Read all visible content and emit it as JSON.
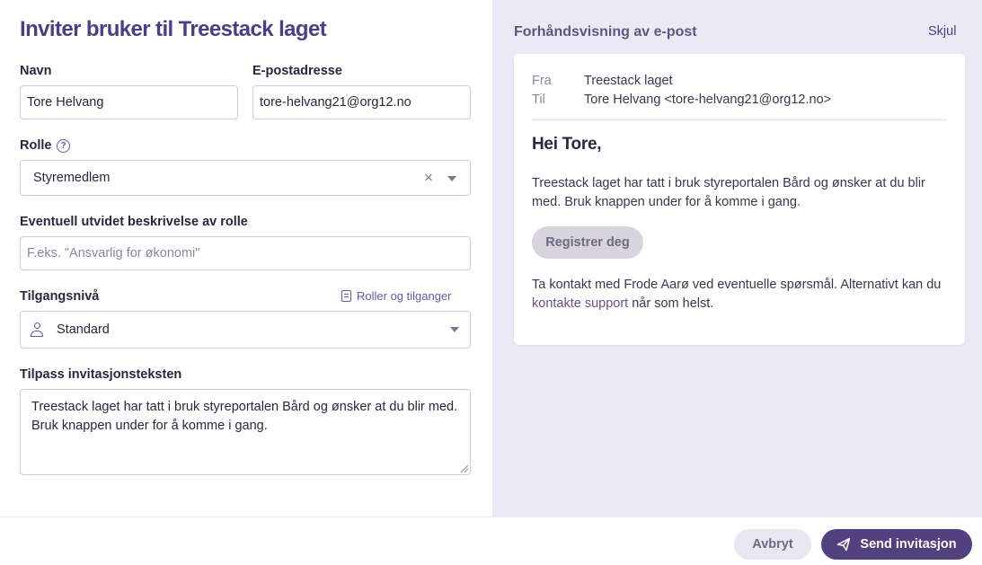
{
  "form": {
    "title": "Inviter bruker til Treestack laget",
    "name_label": "Navn",
    "name_value": "Tore Helvang",
    "email_label": "E-postadresse",
    "email_value": "tore-helvang21@org12.no",
    "role_label": "Rolle",
    "role_help_icon": "?",
    "role_value": "Styremedlem",
    "role_clear": "×",
    "role_description_label": "Eventuell utvidet beskrivelse av rolle",
    "role_description_placeholder": "F.eks. \"Ansvarlig for økonomi\"",
    "access_label": "Tilgangsnivå",
    "roles_link": "Roller og tilganger",
    "access_value": "Standard",
    "invitation_text_label": "Tilpass invitasjonsteksten",
    "invitation_text": "Treestack laget har tatt i bruk styreportalen Bård og ønsker at du blir med. Bruk knappen under for å komme i gang."
  },
  "preview": {
    "title": "Forhåndsvisning av e-post",
    "hide_label": "Skjul",
    "from_label": "Fra",
    "from_value": "Treestack laget",
    "to_label": "Til",
    "to_value": "Tore Helvang <tore-helvang21@org12.no>",
    "greeting": "Hei Tore,",
    "body": "Treestack laget har tatt i bruk styreportalen Bård og ønsker at du blir med. Bruk knappen under for å komme i gang.",
    "register_button": "Registrer deg",
    "contact_text": "Ta kontakt med Frode Aarø ved eventuelle spørsmål. Alternativt kan du ",
    "contact_link": "kontakte support",
    "contact_suffix": " når som helst."
  },
  "footer": {
    "cancel_label": "Avbryt",
    "send_label": "Send invitasjon"
  },
  "colors": {
    "accent": "#52407f",
    "title": "#4e3d86",
    "preview_bg": "#ebe9f3"
  },
  "icons": [
    "help-icon",
    "clear-icon",
    "chevron-down-icon",
    "book-icon",
    "user-icon",
    "send-icon"
  ]
}
